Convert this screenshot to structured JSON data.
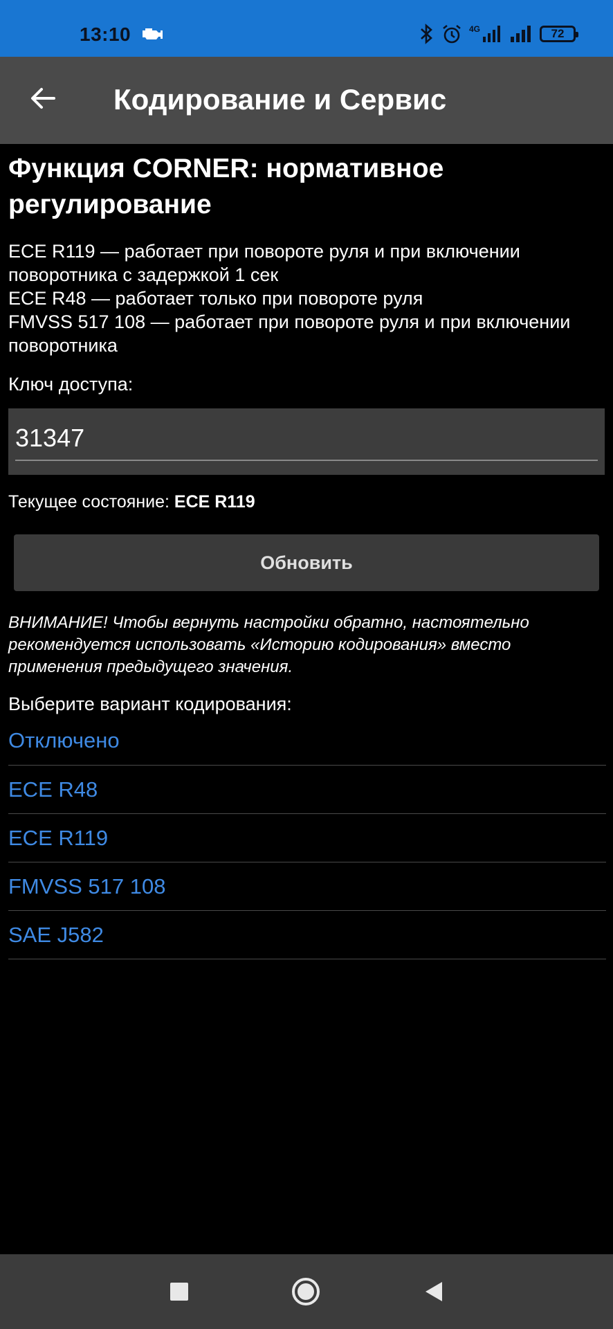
{
  "status_bar": {
    "time": "13:10",
    "network": "4G",
    "battery": "72"
  },
  "toolbar": {
    "title": "Кодирование и Сервис"
  },
  "content": {
    "title": "Функция CORNER: нормативное регулирование",
    "description": [
      "ECE R119 — работает при повороте руля и при включении поворотника с задержкой 1 сек",
      "ECE R48 — работает только при повороте руля",
      "FMVSS 517 108 — работает при повороте руля и при включении поворотника"
    ],
    "access_key_label": "Ключ доступа:",
    "access_key_value": "31347",
    "current_state_label": "Текущее состояние:",
    "current_state_value": "ECE R119",
    "update_button": "Обновить",
    "warning": "ВНИМАНИЕ! Чтобы вернуть настройки обратно, настоятельно рекомендуется использовать «Историю кодирования» вместо применения предыдущего значения.",
    "choose_label": "Выберите вариант кодирования:",
    "options": [
      "Отключено",
      "ECE R48",
      "ECE R119",
      "FMVSS 517 108",
      "SAE J582"
    ]
  },
  "colors": {
    "status_bar": "#1976d2",
    "toolbar": "#4a4a4a",
    "link": "#3f8ae4",
    "nav_bar": "#3c3c3c"
  }
}
